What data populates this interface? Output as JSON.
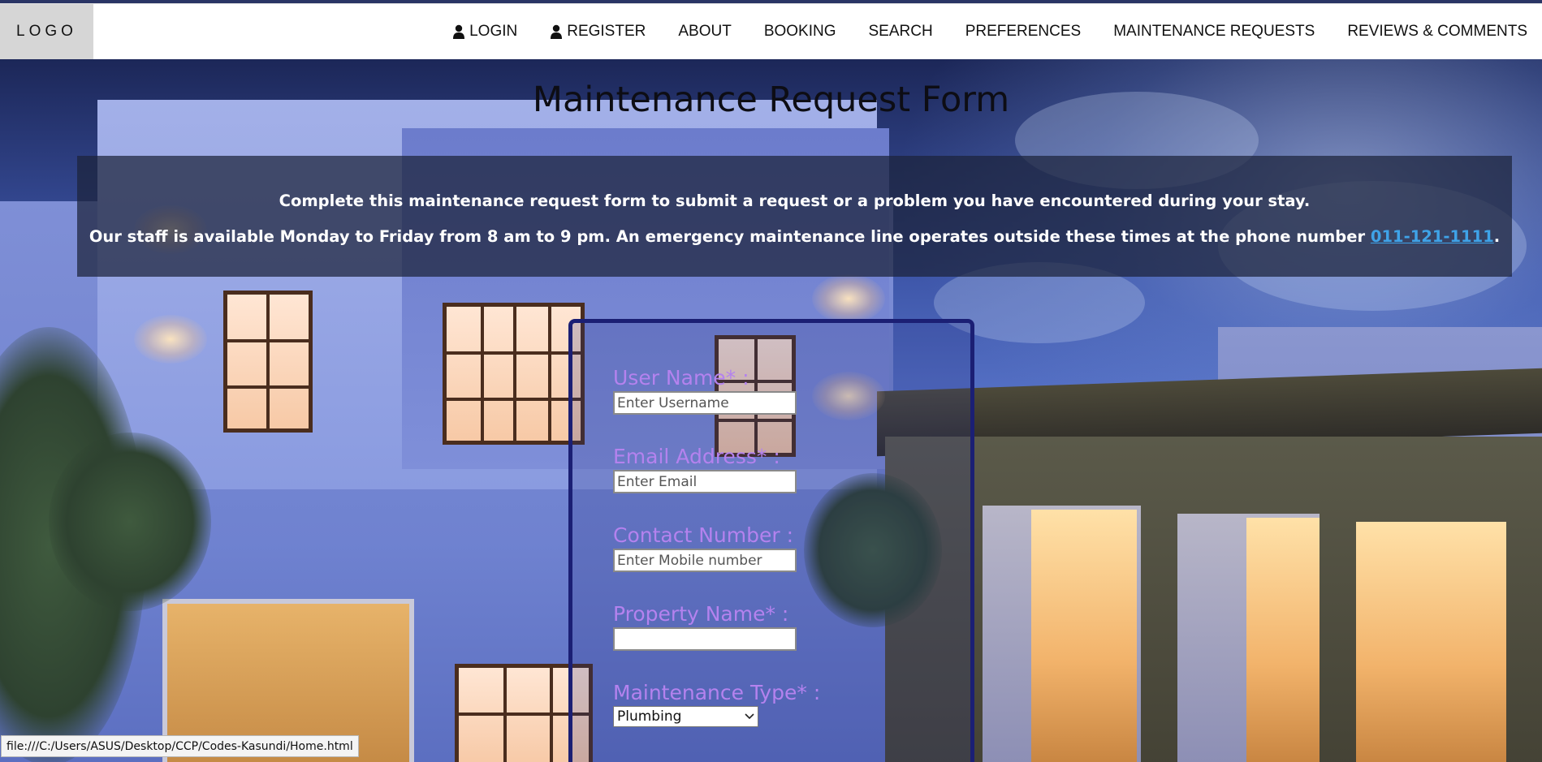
{
  "header": {
    "logo": "LOGO",
    "nav": [
      {
        "label": "LOGIN",
        "icon": "user-icon"
      },
      {
        "label": "REGISTER",
        "icon": "user-icon"
      },
      {
        "label": "ABOUT"
      },
      {
        "label": "BOOKING"
      },
      {
        "label": "SEARCH"
      },
      {
        "label": "PREFERENCES"
      },
      {
        "label": "MAINTENANCE REQUESTS"
      },
      {
        "label": "REVIEWS & COMMENTS"
      }
    ]
  },
  "page": {
    "title": "Maintenance Request Form",
    "info_line1": "Complete this maintenance request form to submit a request or a problem you have encountered during your stay.",
    "info_line2": "Our staff is available Monday to Friday from 8 am to 9 pm. An emergency maintenance line operates outside these times at the phone number ",
    "phone": "011-121-1111",
    "info_line2_end": "."
  },
  "form": {
    "username": {
      "label": "User Name* :",
      "placeholder": "Enter Username",
      "value": ""
    },
    "email": {
      "label": "Email Address* :",
      "placeholder": "Enter Email",
      "value": ""
    },
    "contact": {
      "label": "Contact Number :",
      "placeholder": "Enter Mobile number",
      "value": ""
    },
    "property": {
      "label": "Property Name* :",
      "placeholder": "",
      "value": ""
    },
    "maintenance_type": {
      "label": "Maintenance Type* :",
      "selected": "Plumbing"
    }
  },
  "status_bar": {
    "url": "file:///C:/Users/ASUS/Desktop/CCP/Codes-Kasundi/Home.html"
  },
  "colors": {
    "label": "#b482ee",
    "form_border": "#1b1f74",
    "link": "#3fa3e8",
    "info_panel": "#1c223a"
  }
}
